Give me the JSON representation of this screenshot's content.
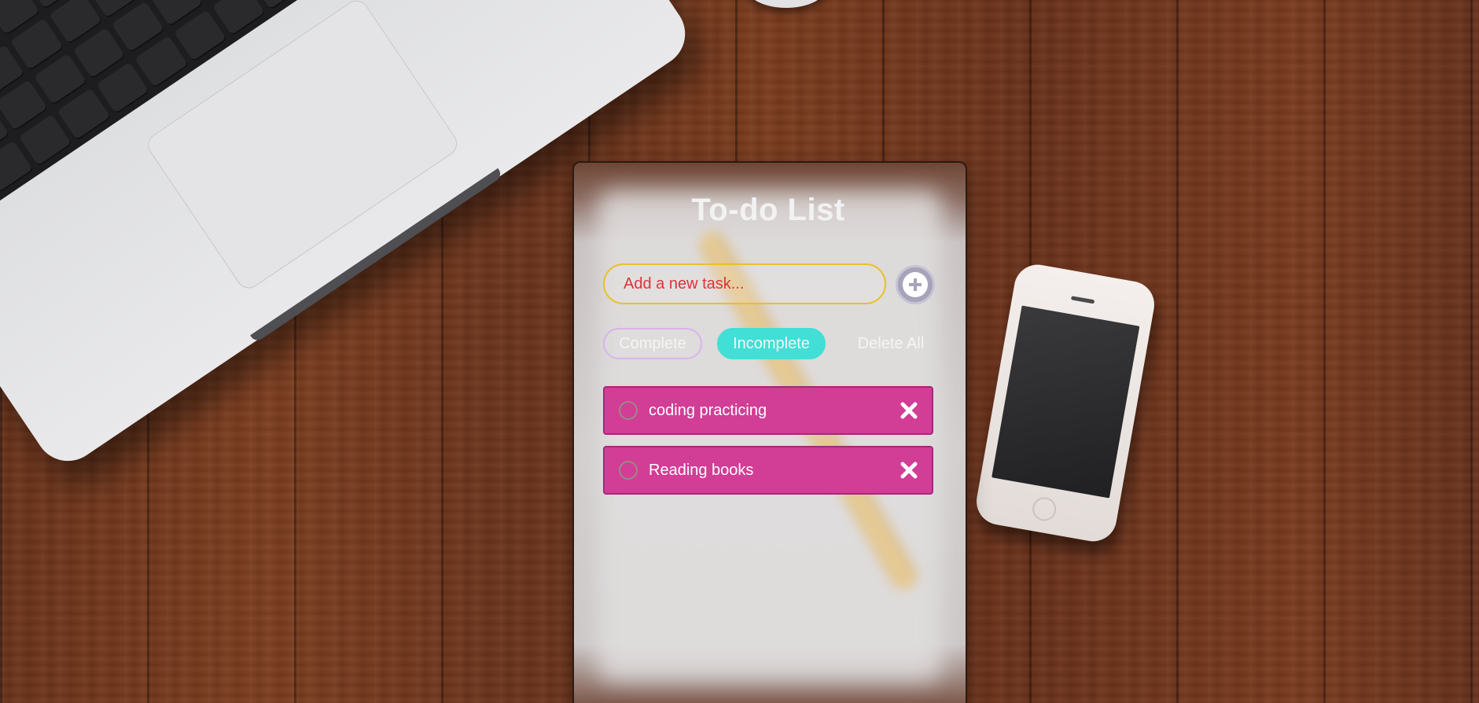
{
  "app": {
    "title": "To-do List"
  },
  "input": {
    "placeholder": "Add a new task...",
    "value": ""
  },
  "add_button": {
    "icon": "plus-circle-icon"
  },
  "filters": {
    "complete_label": "Complete",
    "incomplete_label": "Incomplete",
    "delete_all_label": "Delete All",
    "active": "Incomplete"
  },
  "tasks": [
    {
      "label": "coding practicing",
      "completed": false
    },
    {
      "label": "Reading books",
      "completed": false
    }
  ],
  "colors": {
    "task_bg": "#d23d95",
    "incomplete_bg": "#42dfd6",
    "input_border": "#e8c125",
    "placeholder": "#e0323a",
    "complete_border": "#d8b4ea"
  }
}
